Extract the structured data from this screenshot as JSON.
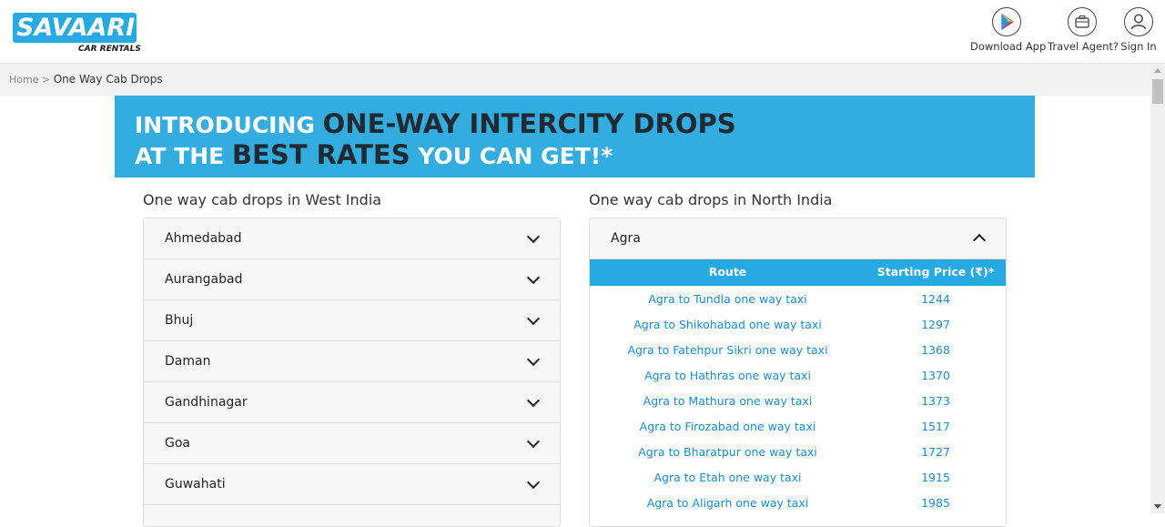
{
  "header": {
    "logo_text": "SAVAARI",
    "logo_sub": "CAR RENTALS",
    "actions": [
      {
        "label": "Download App",
        "icon": "play-store-icon"
      },
      {
        "label": "Travel Agent?",
        "icon": "briefcase-icon"
      },
      {
        "label": "Sign In",
        "icon": "user-icon"
      }
    ]
  },
  "breadcrumb": {
    "home": "Home",
    "separator": ">",
    "current": "One Way Cab Drops"
  },
  "banner": {
    "line1_a": "INTRODUCING ",
    "line1_b": "ONE-WAY INTERCITY DROPS",
    "line2_a": "AT THE ",
    "line2_b": "BEST RATES",
    "line2_c": " YOU CAN GET!*"
  },
  "west": {
    "title": "One way cab drops in West India",
    "cities": [
      "Ahmedabad",
      "Aurangabad",
      "Bhuj",
      "Daman",
      "Gandhinagar",
      "Goa",
      "Guwahati"
    ]
  },
  "north": {
    "title": "One way cab drops in North India",
    "open_city": "Agra",
    "col_route": "Route",
    "col_price": "Starting Price (₹)*",
    "rows": [
      {
        "route": "Agra to Tundla one way taxi",
        "price": "1244"
      },
      {
        "route": "Agra to Shikohabad one way taxi",
        "price": "1297"
      },
      {
        "route": "Agra to Fatehpur Sikri one way taxi",
        "price": "1368"
      },
      {
        "route": "Agra to Hathras one way taxi",
        "price": "1370"
      },
      {
        "route": "Agra to Mathura one way taxi",
        "price": "1373"
      },
      {
        "route": "Agra to Firozabad one way taxi",
        "price": "1517"
      },
      {
        "route": "Agra to Bharatpur one way taxi",
        "price": "1727"
      },
      {
        "route": "Agra to Etah one way taxi",
        "price": "1915"
      },
      {
        "route": "Agra to Aligarh one way taxi",
        "price": "1985"
      }
    ]
  },
  "colors": {
    "brand": "#27a9e1",
    "link": "#1a8bd2",
    "banner_dark": "#1f2a33"
  }
}
